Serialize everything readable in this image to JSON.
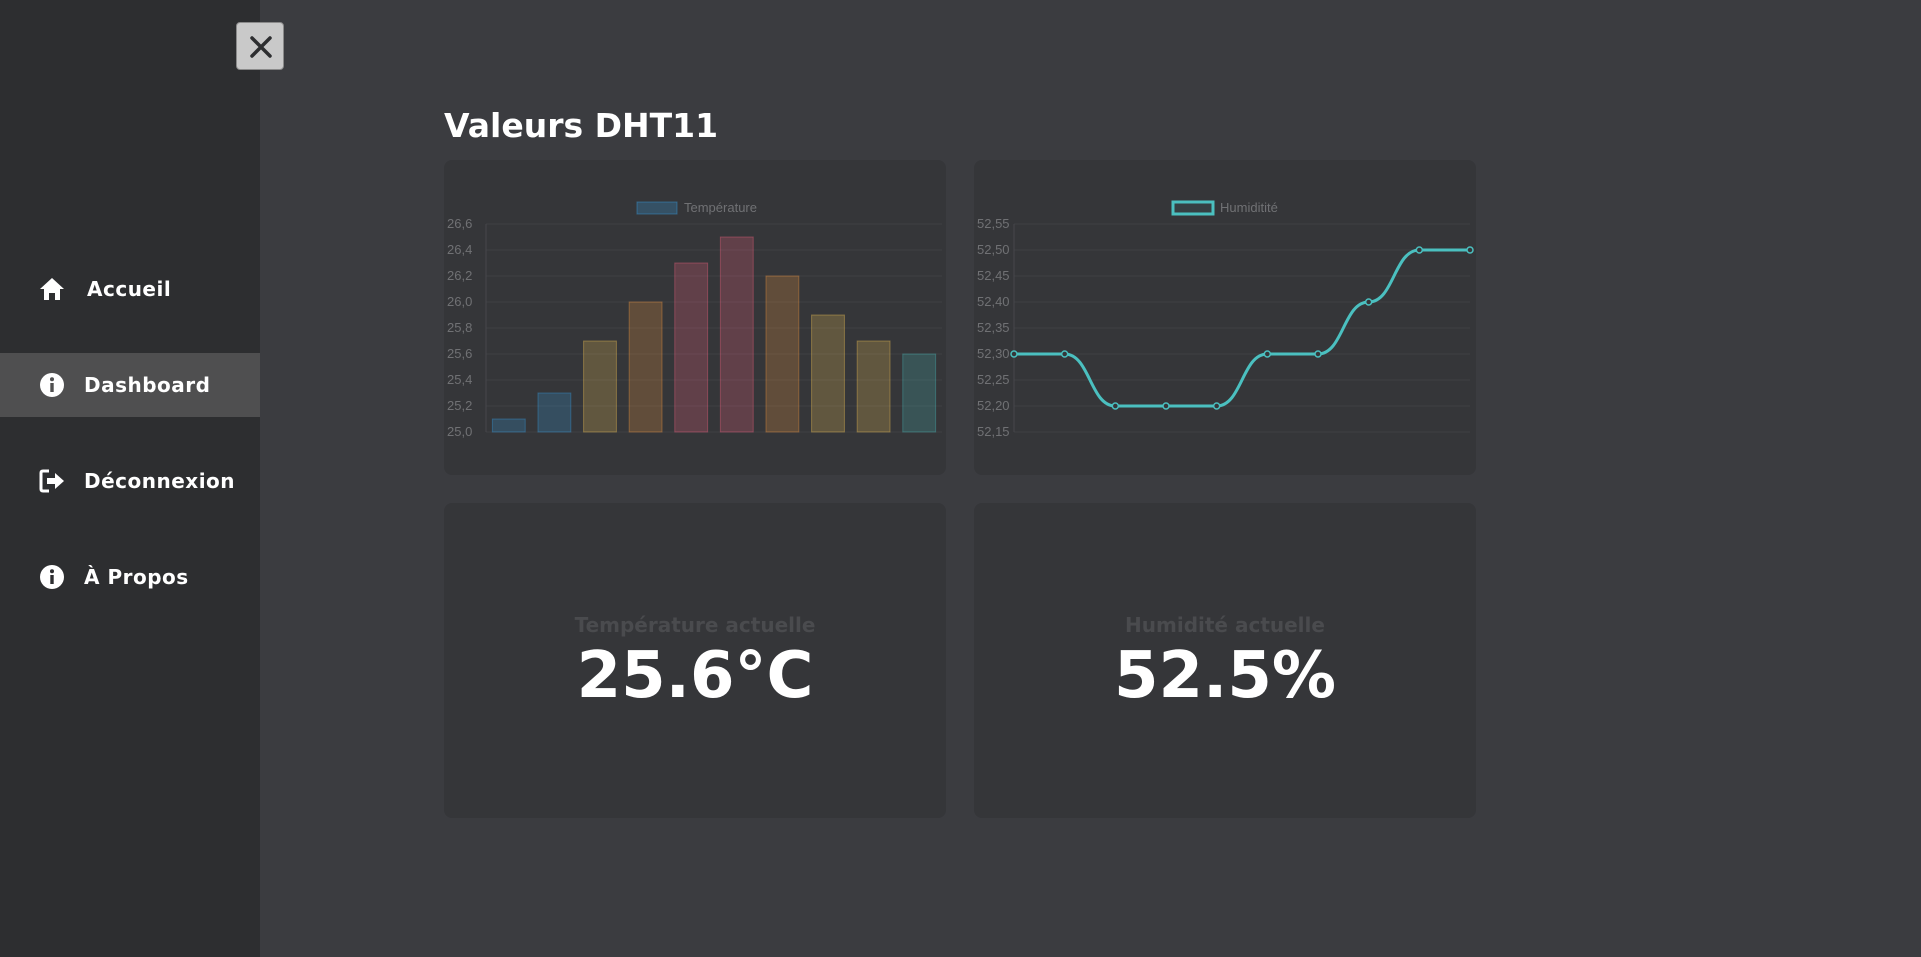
{
  "sidebar": {
    "items": [
      {
        "label": "Accueil",
        "icon": "home-icon"
      },
      {
        "label": "Dashboard",
        "icon": "info-icon",
        "active": true
      },
      {
        "label": "Déconnexion",
        "icon": "logout-icon"
      },
      {
        "label": "À Propos",
        "icon": "info-icon"
      }
    ]
  },
  "header": {
    "title": "Valeurs DHT11"
  },
  "colors": {
    "background": "#3b3c40",
    "sidebar": "#2d2e30",
    "card": "#353639",
    "active_item": "#4f4f50",
    "humidity_line": "#4bc0c0"
  },
  "chart_data": [
    {
      "type": "bar",
      "legend": "Température",
      "legend_position": "top",
      "categories": [
        "",
        "",
        "",
        "",
        "",
        "",
        "",
        "",
        "",
        ""
      ],
      "values": [
        25.1,
        25.3,
        25.7,
        26.0,
        26.3,
        26.5,
        26.2,
        25.9,
        25.7,
        25.6
      ],
      "colors": [
        "#36a2eb",
        "#36a2eb",
        "#ffcd56",
        "#ff9f40",
        "#ff6384",
        "#ff6384",
        "#ff9f40",
        "#ffcd56",
        "#ffcd56",
        "#4bc0c0"
      ],
      "ylim": [
        25.0,
        26.6
      ],
      "yticks": [
        "26,6",
        "26,4",
        "26,2",
        "26,0",
        "25,8",
        "25,6",
        "25,4",
        "25,2",
        "25,0"
      ],
      "grid": true
    },
    {
      "type": "line",
      "legend": "Humiditité",
      "legend_position": "top",
      "categories": [
        "",
        "",
        "",
        "",
        "",
        "",
        "",
        "",
        "",
        ""
      ],
      "values": [
        52.3,
        52.3,
        52.2,
        52.2,
        52.2,
        52.3,
        52.3,
        52.4,
        52.5,
        52.5
      ],
      "color": "#4bc0c0",
      "ylim": [
        52.15,
        52.55
      ],
      "yticks": [
        "52,55",
        "52,50",
        "52,45",
        "52,40",
        "52,35",
        "52,30",
        "52,25",
        "52,20",
        "52,15"
      ],
      "grid": true
    }
  ],
  "stats": {
    "temperature_label": "Température actuelle",
    "temperature_value": "25.6°C",
    "humidity_label": "Humidité actuelle",
    "humidity_value": "52.5%"
  }
}
